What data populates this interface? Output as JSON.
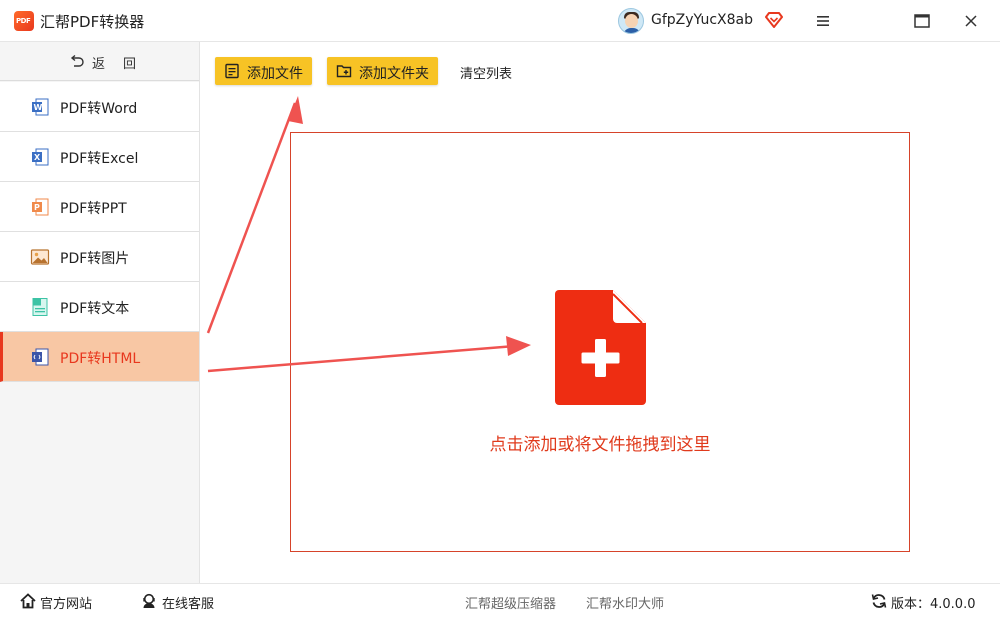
{
  "app": {
    "logo_text": "PDF",
    "title": "汇帮PDF转换器"
  },
  "user": {
    "name": "GfpZyYucX8ab"
  },
  "sidebar": {
    "back_label": "返回",
    "items": [
      {
        "label": "PDF转Word",
        "icon": "word-icon"
      },
      {
        "label": "PDF转Excel",
        "icon": "excel-icon"
      },
      {
        "label": "PDF转PPT",
        "icon": "ppt-icon"
      },
      {
        "label": "PDF转图片",
        "icon": "image-icon"
      },
      {
        "label": "PDF转文本",
        "icon": "text-icon"
      },
      {
        "label": "PDF转HTML",
        "icon": "html-icon",
        "active": true
      }
    ]
  },
  "toolbar": {
    "add_file": "添加文件",
    "add_folder": "添加文件夹",
    "clear_list": "清空列表"
  },
  "dropzone": {
    "text": "点击添加或将文件拖拽到这里"
  },
  "footer": {
    "website": "官方网站",
    "support": "在线客服",
    "compressor": "汇帮超级压缩器",
    "watermark": "汇帮水印大师",
    "version": "版本：4.0.0.0"
  },
  "colors": {
    "accent": "#e8381e",
    "button_yellow": "#f7c325",
    "active_nav_bg": "#f8c7a4",
    "arrow": "#ef5350"
  }
}
